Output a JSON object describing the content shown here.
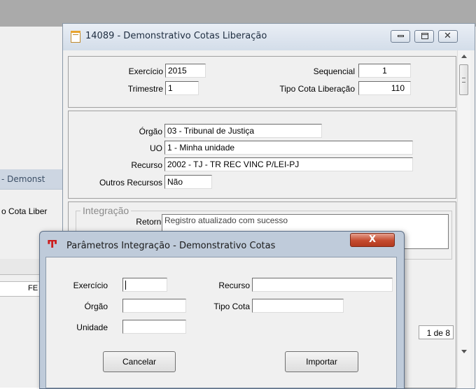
{
  "background_window": {
    "title": "- Demonst",
    "field_label": "o Cota Liber",
    "table_cell": "FE"
  },
  "main_window": {
    "title": "14089 - Demonstrativo Cotas Liberação",
    "fields": {
      "exercicio_label": "Exercício",
      "exercicio_value": "2015",
      "sequencial_label": "Sequencial",
      "sequencial_value": "1",
      "trimestre_label": "Trimestre",
      "trimestre_value": "1",
      "tipo_cota_label": "Tipo Cota Liberação",
      "tipo_cota_value": "110",
      "orgao_label": "Órgão",
      "orgao_value": "03 - Tribunal de Justiça",
      "uo_label": "UO",
      "uo_value": "1 -  Minha unidade",
      "recurso_label": "Recurso",
      "recurso_value": "2002 - TJ - TR REC VINC P/LEI-PJ",
      "outros_recursos_label": "Outros Recursos",
      "outros_recursos_value": "Não"
    },
    "integracao": {
      "legend": "Integração",
      "retorno_label": "Retorno",
      "retorno_value": "Registro atualizado com sucesso"
    },
    "pager": "1 de 8"
  },
  "dialog": {
    "title": "Parâmetros Integração - Demonstrativo Cotas",
    "close_glyph": "X",
    "fields": {
      "exercicio_label": "Exercício",
      "exercicio_value": "",
      "recurso_label": "Recurso",
      "recurso_value": "",
      "orgao_label": "Órgão",
      "orgao_value": "",
      "tipo_cota_label": "Tipo Cota",
      "tipo_cota_value": "",
      "unidade_label": "Unidade",
      "unidade_value": ""
    },
    "buttons": {
      "cancel": "Cancelar",
      "import": "Importar"
    }
  }
}
